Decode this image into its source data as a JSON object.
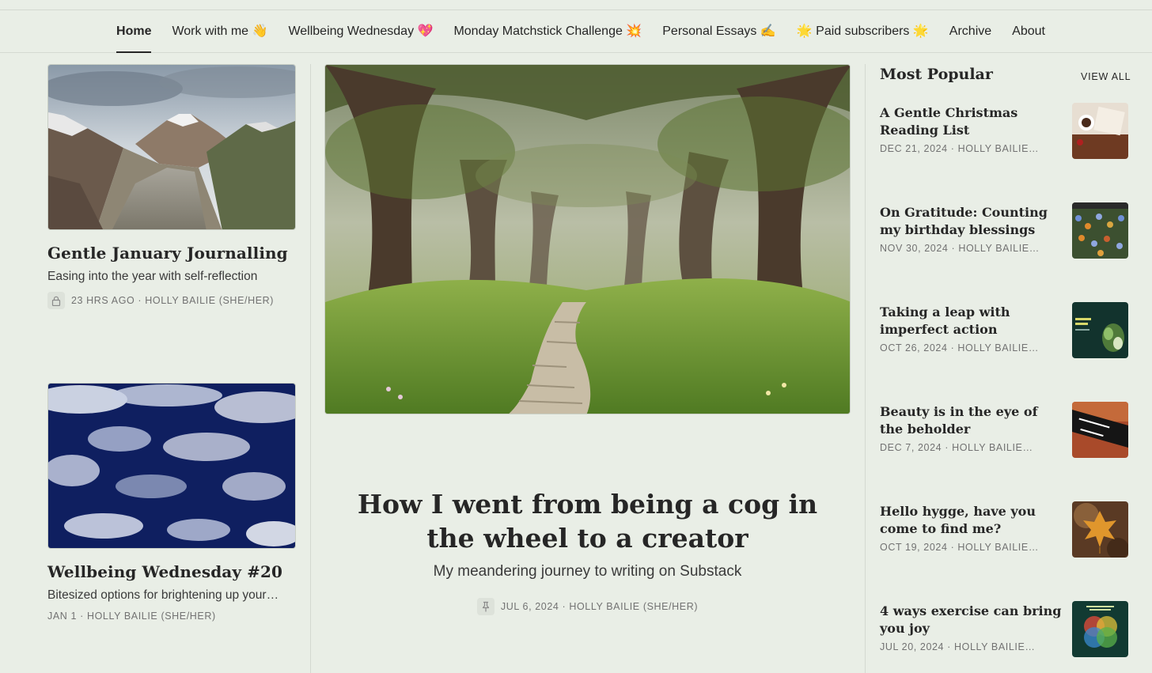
{
  "nav": {
    "items": [
      {
        "label": "Home",
        "active": true
      },
      {
        "label": "Work with me 👋"
      },
      {
        "label": "Wellbeing Wednesday 💖"
      },
      {
        "label": "Monday Matchstick Challenge 💥"
      },
      {
        "label": "Personal Essays ✍️"
      },
      {
        "label": "🌟 Paid subscribers 🌟"
      },
      {
        "label": "Archive"
      },
      {
        "label": "About"
      }
    ]
  },
  "left_posts": [
    {
      "title": "Gentle January Journalling",
      "subtitle": "Easing into the year with self-reflection",
      "meta": "23 HRS AGO · HOLLY BAILIE (SHE/HER)",
      "locked": true,
      "image": "mountain-valley-photo"
    },
    {
      "title": "Wellbeing Wednesday #20",
      "subtitle": "Bitesized options for brightening up your…",
      "meta": "JAN 1 · HOLLY BAILIE (SHE/HER)",
      "locked": false,
      "image": "blue-sky-clouds-photo"
    }
  ],
  "feature": {
    "title": "How I went from being a cog in the wheel to a creator",
    "subtitle": "My meandering journey to writing on Substack",
    "meta": "JUL 6, 2024 · HOLLY BAILIE (SHE/HER)",
    "pinned": true,
    "image": "enchanted-forest-path-illustration"
  },
  "popular": {
    "heading": "Most Popular",
    "view_all": "VIEW ALL",
    "items": [
      {
        "title": "A Gentle Christmas Reading List",
        "meta": "DEC 21, 2024 · HOLLY BAILIE…",
        "thumb": "books-coffee"
      },
      {
        "title": "On Gratitude: Counting my birthday blessings",
        "meta": "NOV 30, 2024 · HOLLY BAILIE…",
        "thumb": "flower-meadow"
      },
      {
        "title": "Taking a leap with imperfect action",
        "meta": "OCT 26, 2024 · HOLLY BAILIE…",
        "thumb": "website-screenshot"
      },
      {
        "title": "Beauty is in the eye of the beholder",
        "meta": "DEC 7, 2024 · HOLLY BAILIE…",
        "thumb": "street-sign"
      },
      {
        "title": "Hello hygge, have you come to find me?",
        "meta": "OCT 19, 2024 · HOLLY BAILIE…",
        "thumb": "autumn-leaf"
      },
      {
        "title": "4 ways exercise can bring you joy",
        "meta": "JUL 20, 2024 · HOLLY BAILIE…",
        "thumb": "exercise-venn-diagram"
      }
    ]
  },
  "colors": {
    "background": "#e9eee6",
    "text": "#262626",
    "meta": "#727272",
    "divider": "#d4d9d1"
  }
}
